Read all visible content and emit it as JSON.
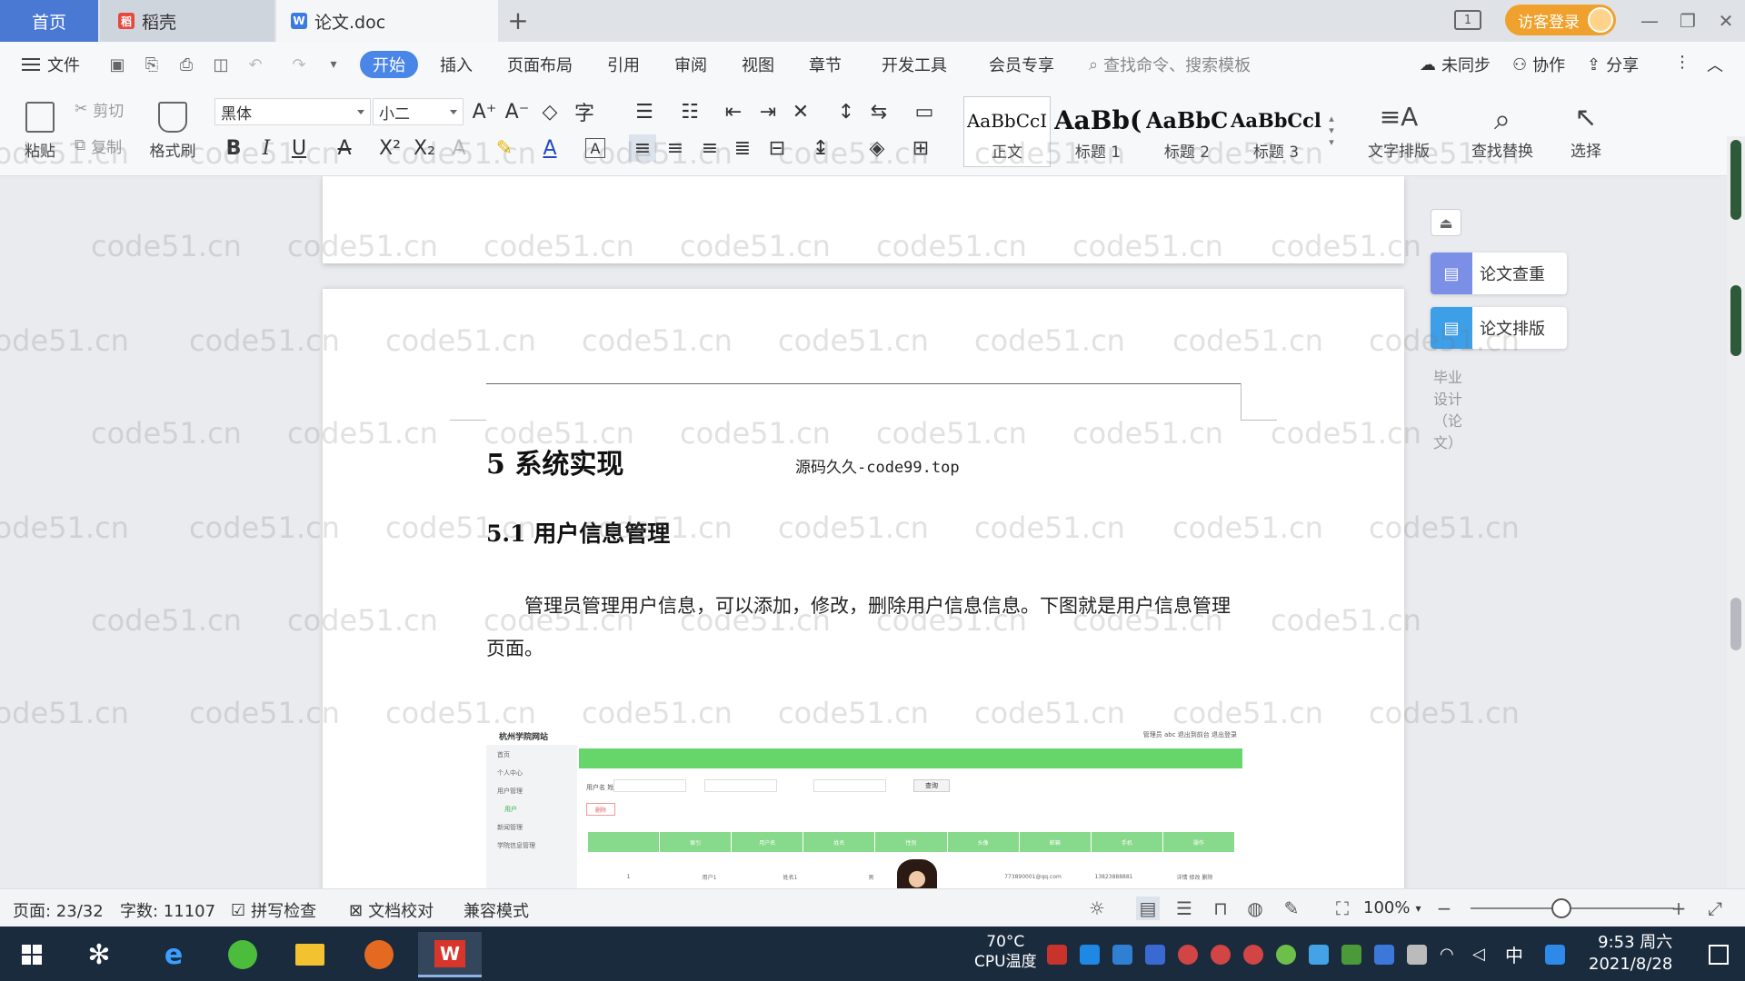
{
  "tabs": {
    "home": "首页",
    "daoke": "稻壳",
    "doc": "论文.doc"
  },
  "titlebar": {
    "visitor_login": "访客登录",
    "layout_badge": "1"
  },
  "menu": {
    "file": "文件",
    "items": [
      "开始",
      "插入",
      "页面布局",
      "引用",
      "审阅",
      "视图",
      "章节",
      "开发工具",
      "会员专享"
    ],
    "search_placeholder": "查找命令、搜索模板",
    "unsynced": "未同步",
    "collab": "协作",
    "share": "分享"
  },
  "ribbon": {
    "paste": "粘贴",
    "cut": "剪切",
    "copy": "复制",
    "format_painter": "格式刷",
    "font_name": "黑体",
    "font_size": "小二",
    "styles": [
      {
        "sample": "AaBbCcI",
        "name": "正文"
      },
      {
        "sample": "AaBb(",
        "name": "标题 1"
      },
      {
        "sample": "AaBbC",
        "name": "标题 2"
      },
      {
        "sample": "AaBbCcl",
        "name": "标题 3"
      }
    ],
    "text_layout": "文字排版",
    "find_replace": "查找替换",
    "select": "选择"
  },
  "document": {
    "header": "毕业设计（论文）",
    "chapter_title": "5  系统实现",
    "inline_watermark": "源码久久-code99.top",
    "section_title": "5.1 用户信息管理",
    "paragraph": "管理员管理用户信息，可以添加，修改，删除用户信息信息。下图就是用户信息管理页面。"
  },
  "embedded_screenshot": {
    "brand": "杭州学院网站",
    "top_links": "管理员 abc   退出到前台   退出登录",
    "nav_items": [
      "首页",
      "个人中心",
      "用户管理",
      "用户",
      "新闻管理",
      "学院信息管理"
    ],
    "search_labels": "用户名              姓名              性别",
    "search_button": "查询",
    "delete_button": "删除",
    "table_headers": [
      "",
      "索引",
      "用户名",
      "姓名",
      "性别",
      "头像",
      "邮箱",
      "手机",
      "操作"
    ],
    "row": [
      "1",
      "用户1",
      "姓名1",
      "男",
      "",
      "773890001@qq.com",
      "13823888881",
      "详情 修改 删除"
    ]
  },
  "watermark": "code51.cn",
  "side_panel": {
    "check": "论文查重",
    "format": "论文排版"
  },
  "status": {
    "page": "页面: 23/32",
    "words": "字数: 11107",
    "spell": "拼写检查",
    "proof": "文档校对",
    "compat": "兼容模式",
    "zoom": "100%"
  },
  "taskbar": {
    "cpu_temp": "70°C",
    "cpu_label": "CPU温度",
    "ime": "中",
    "time": "9:53 周六",
    "date": "2021/8/28"
  },
  "colors": {
    "accent": "#4a86e8",
    "visitor": "#f0a12d",
    "taskbar": "#1b2b3e",
    "green": "#66d66b"
  }
}
